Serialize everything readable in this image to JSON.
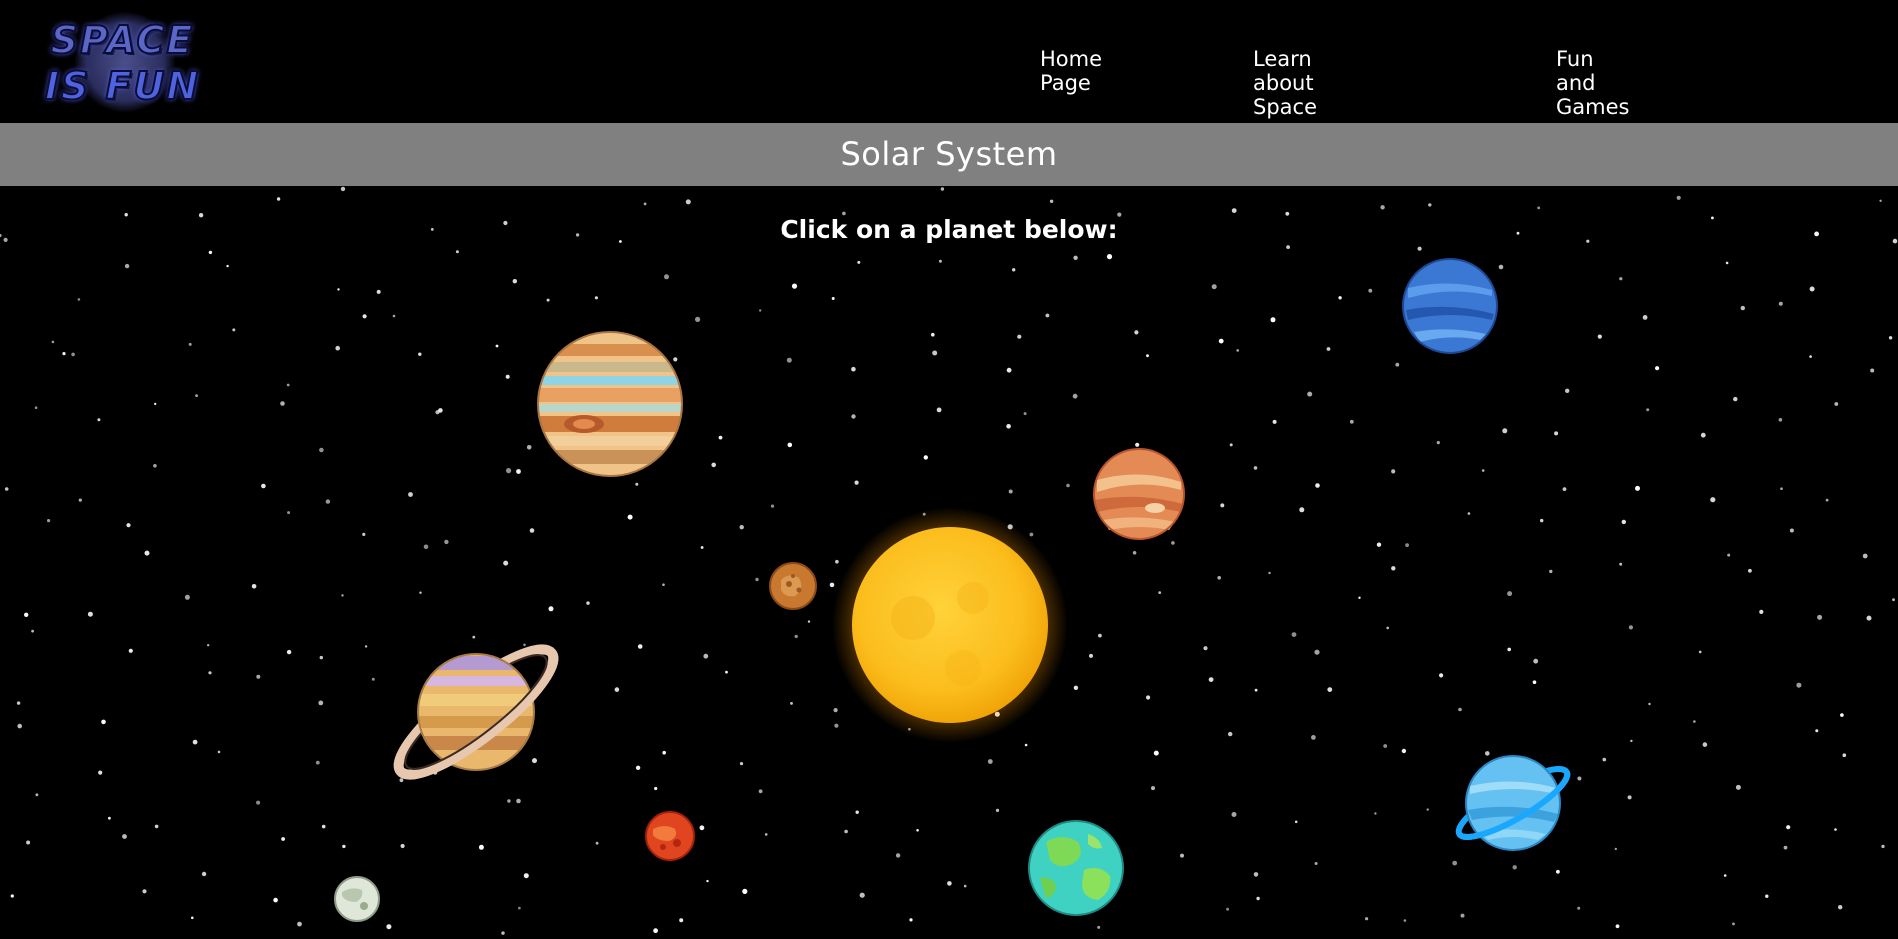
{
  "logo": {
    "line1": "SPACE",
    "line2": "IS FUN"
  },
  "nav": {
    "home": "Home Page",
    "learn": "Learn about Space",
    "fun": "Fun and Games"
  },
  "page_title": "Solar System",
  "instruction": "Click on a planet below:",
  "colors": {
    "background": "#000000",
    "title_band": "#808080",
    "text": "#ffffff"
  },
  "planets": [
    {
      "name": "sun",
      "icon": "sun-icon"
    },
    {
      "name": "mercury",
      "icon": "mercury-icon"
    },
    {
      "name": "venus",
      "icon": "venus-icon"
    },
    {
      "name": "earth",
      "icon": "earth-icon"
    },
    {
      "name": "mars",
      "icon": "mars-icon"
    },
    {
      "name": "jupiter",
      "icon": "jupiter-icon"
    },
    {
      "name": "saturn",
      "icon": "saturn-icon"
    },
    {
      "name": "uranus",
      "icon": "uranus-icon"
    },
    {
      "name": "neptune",
      "icon": "neptune-icon"
    },
    {
      "name": "pluto",
      "icon": "pluto-icon"
    }
  ]
}
